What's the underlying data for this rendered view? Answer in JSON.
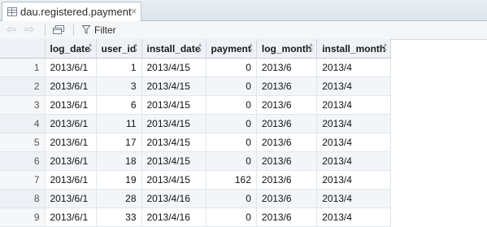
{
  "tab": {
    "title": "dau.registered.payment",
    "close_glyph": "×",
    "icon": "table-icon"
  },
  "toolbar": {
    "back_icon": "arrow-left-icon",
    "forward_icon": "arrow-right-icon",
    "popout_icon": "popout-window-icon",
    "filter_icon": "funnel-icon",
    "filter_label": "Filter"
  },
  "table": {
    "columns": [
      "log_date",
      "user_id",
      "install_date",
      "payment",
      "log_month",
      "install_month"
    ],
    "rows": [
      {
        "idx": "1",
        "cells": [
          "2013/6/1",
          "1",
          "2013/4/15",
          "0",
          "2013/6",
          "2013/4"
        ]
      },
      {
        "idx": "2",
        "cells": [
          "2013/6/1",
          "3",
          "2013/4/15",
          "0",
          "2013/6",
          "2013/4"
        ]
      },
      {
        "idx": "3",
        "cells": [
          "2013/6/1",
          "6",
          "2013/4/15",
          "0",
          "2013/6",
          "2013/4"
        ]
      },
      {
        "idx": "4",
        "cells": [
          "2013/6/1",
          "11",
          "2013/4/15",
          "0",
          "2013/6",
          "2013/4"
        ]
      },
      {
        "idx": "5",
        "cells": [
          "2013/6/1",
          "17",
          "2013/4/15",
          "0",
          "2013/6",
          "2013/4"
        ]
      },
      {
        "idx": "6",
        "cells": [
          "2013/6/1",
          "18",
          "2013/4/15",
          "0",
          "2013/6",
          "2013/4"
        ]
      },
      {
        "idx": "7",
        "cells": [
          "2013/6/1",
          "19",
          "2013/4/15",
          "162",
          "2013/6",
          "2013/4"
        ]
      },
      {
        "idx": "8",
        "cells": [
          "2013/6/1",
          "28",
          "2013/4/16",
          "0",
          "2013/6",
          "2013/4"
        ]
      },
      {
        "idx": "9",
        "cells": [
          "2013/6/1",
          "33",
          "2013/4/16",
          "0",
          "2013/6",
          "2013/4"
        ]
      }
    ]
  }
}
